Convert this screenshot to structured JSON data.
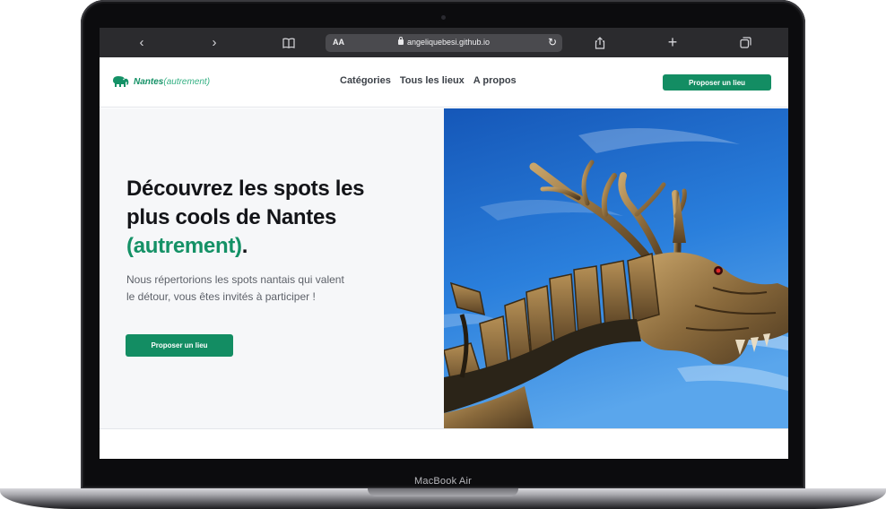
{
  "device": {
    "label": "MacBook Air"
  },
  "browser": {
    "back_icon": "‹",
    "forward_icon": "›",
    "bookmarks_icon": "book-icon",
    "text_size": "AA",
    "url": "angeliquebesi.github.io",
    "reload_icon": "↻",
    "share_icon": "share-icon",
    "new_tab_icon": "+",
    "tabs_icon": "tabs-icon"
  },
  "site": {
    "logo": {
      "name": "Nantes",
      "suffix": "(autrement)"
    },
    "nav": [
      {
        "label": "Catégories"
      },
      {
        "label": "Tous les lieux"
      },
      {
        "label": "A propos"
      }
    ],
    "header_cta": "Proposer un lieu",
    "hero": {
      "title_line1": "Découvrez les spots les",
      "title_line2": "plus cools de Nantes",
      "title_accent": "(autrement)",
      "title_end": ".",
      "subtitle": "Nous répertorions les spots nantais qui valent le détour, vous êtes invités à participer !",
      "cta": "Proposer un lieu"
    }
  },
  "colors": {
    "brand_green": "#138d63",
    "hero_bg": "#f6f7f9",
    "sky_blue": "#1f6fd1"
  }
}
